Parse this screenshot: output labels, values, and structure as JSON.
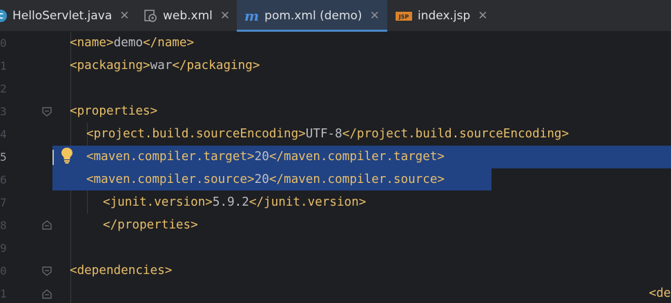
{
  "tabs": [
    {
      "label": "HelloServlet.java",
      "icon": "java-class-icon",
      "active": false
    },
    {
      "label": "web.xml",
      "icon": "web-xml-icon",
      "active": false
    },
    {
      "label": "pom.xml (demo)",
      "icon": "maven-icon",
      "active": true
    },
    {
      "label": "index.jsp",
      "icon": "jsp-icon",
      "active": false
    }
  ],
  "close_glyph": "✕",
  "icon_glyphs": {
    "java": "C",
    "maven": "m"
  },
  "gutter": {
    "line_numbers": [
      "0",
      "1",
      "2",
      "3",
      "4",
      "5",
      "6",
      "7",
      "8",
      "9",
      "0",
      "1"
    ],
    "current_line_number": "5"
  },
  "code": {
    "l0": {
      "open": "<name>",
      "text": "demo",
      "close": "</name>"
    },
    "l1": {
      "open": "<packaging>",
      "text": "war",
      "close": "</packaging>"
    },
    "l3": {
      "open": "<properties>"
    },
    "l4": {
      "open": "<project.build.sourceEncoding>",
      "text": "UTF-8",
      "close": "</project.build.sourceEncoding>"
    },
    "l5": {
      "open": "<maven.compiler.target>",
      "text": "20",
      "close": "</maven.compiler.target>"
    },
    "l6": {
      "open": "<maven.compiler.source>",
      "text": "20",
      "close": "</maven.compiler.source>"
    },
    "l7": {
      "open": "<junit.version>",
      "text": "5.9.2",
      "close": "</junit.version>"
    },
    "l8": {
      "close": "</properties>"
    },
    "l10": {
      "open": "<dependencies>"
    },
    "l11": {
      "open": "<de"
    }
  },
  "colors": {
    "tag": "#e8bf6a",
    "text": "#bcbec4",
    "selection": "#214283",
    "active_tab_underline": "#4a88c7",
    "background": "#1e1f22"
  }
}
